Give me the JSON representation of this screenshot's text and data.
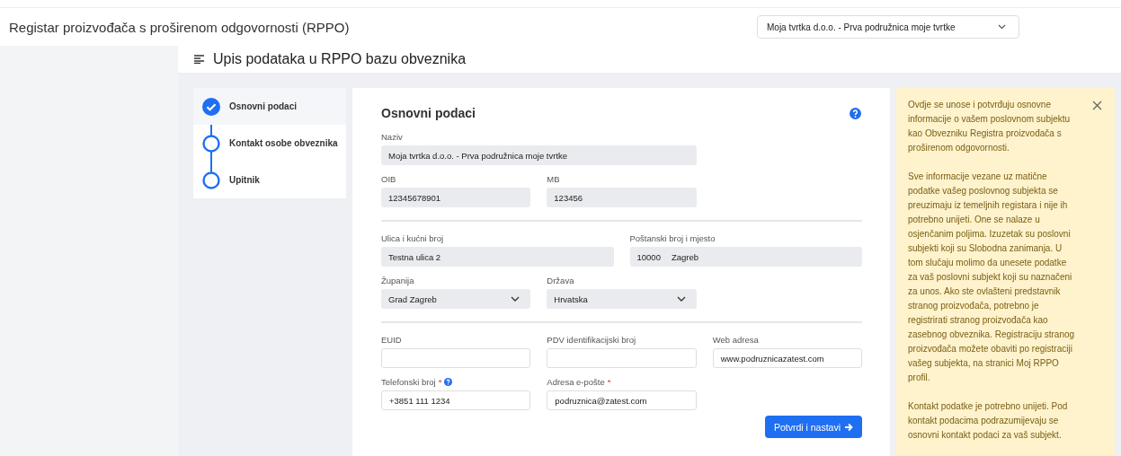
{
  "header": {
    "title": "Registar proizvođača s proširenom odgovornosti (RPPO)",
    "company_select": "Moja tvrtka d.o.o. - Prva podružnica moje tvrtke"
  },
  "page_title": "Upis podataka u RPPO bazu obveznika",
  "steps": [
    {
      "label": "Osnovni podaci",
      "done": true,
      "selected": true
    },
    {
      "label": "Kontakt osobe obveznika",
      "done": false,
      "selected": false
    },
    {
      "label": "Upitnik",
      "done": false,
      "selected": false
    }
  ],
  "form": {
    "title": "Osnovni podaci",
    "help": true,
    "sections": [
      [
        [
          {
            "label": "Naziv",
            "kind": "readonly",
            "value": "Moja tvrtka d.o.o. - Prva podružnica moje tvrtke"
          }
        ],
        [
          {
            "label": "OIB",
            "kind": "readonly",
            "value": "12345678901"
          },
          {
            "label": "MB",
            "kind": "readonly",
            "value": "123456"
          }
        ]
      ],
      [
        [
          {
            "label": "Ulica i kućni broj",
            "kind": "readonly",
            "value": "Testna ulica 2"
          },
          {
            "label": "Poštanski broj i mjesto",
            "kind": "readonly",
            "values": [
              "10000",
              "Zagreb"
            ]
          }
        ],
        [
          {
            "label": "Županija",
            "kind": "select",
            "value": "Grad Zagreb"
          },
          {
            "label": "Država",
            "kind": "select",
            "value": "Hrvatska"
          }
        ]
      ],
      [
        [
          {
            "label": "EUID",
            "kind": "input"
          },
          {
            "label": "PDV identifikacijski broj",
            "kind": "input"
          },
          {
            "label": "Web adresa",
            "kind": "input",
            "value": "www.podruznicazatest.com"
          }
        ],
        [
          {
            "label": "Telefonski broj",
            "marker": "*",
            "help": true,
            "kind": "input",
            "value": "+3851 111 1234"
          },
          {
            "label": "Adresa e-pošte",
            "marker": "*",
            "kind": "input",
            "value": "podruznica@zatest.com"
          }
        ]
      ]
    ],
    "submit": "Potvrdi i nastavi"
  },
  "info": {
    "closable": true,
    "paragraphs": [
      "Ovdje se unose i potvrđuju osnovne informacije o vašem poslovnom subjektu kao Obvezniku Registra proizvođača s proširenom odgovornosti.",
      "Sve informacije vezane uz matične podatke vašeg poslovnog subjekta se preuzimaju iz temeljnih registara i nije ih potrebno unijeti. One se nalaze u osjenčanim poljima. Izuzetak su poslovni subjekti koji su Slobodna zanimanja. U tom slučaju molimo da unesete podatke za vaš poslovni subjekt koji su naznačeni za unos. Ako ste ovlašteni predstavnik stranog proizvođača, potrebno je registrirati stranog proizvođača kao zasebnog obveznika. Registraciju stranog proizvođača možete obaviti po registraciji vašeg subjekta, na stranici Moj RPPO profil.",
      "Kontakt podatke je potrebno unijeti. Pod kontakt podacima podrazumijevaju se osnovni kontakt podaci za vaš subjekt."
    ]
  }
}
